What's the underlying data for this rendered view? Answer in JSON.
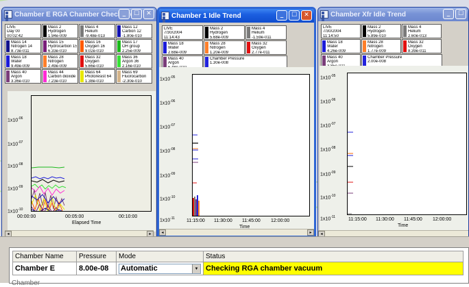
{
  "windows": [
    {
      "id": "e",
      "title": "Chamber E RGA Chamber Check Trend",
      "cells": [
        [
          "LIVE",
          "Day 00",
          "00:02:42"
        ],
        [
          "Mass 2",
          "Hydrogen",
          "1.94e-009"
        ],
        [
          "Mass 4",
          "Helium",
          "-9.48e-013"
        ],
        [
          "Mass 12",
          "Carbon 12",
          "-1.80e-010"
        ],
        [
          "Mass 14",
          "Nitrogen 14",
          "8.73e-011"
        ],
        [
          "Mass 15",
          "Hydrocarbon 15",
          "6.33e-010"
        ],
        [
          "Mass 16",
          "Oxygen 16",
          "9.02e-010"
        ],
        [
          "Mass 17",
          "OH group",
          "2.25e-009"
        ],
        [
          "Mass 18",
          "Water",
          "9.49e-009"
        ],
        [
          "Mass 28",
          "Nitrogen",
          "2.49e-009"
        ],
        [
          "Mass 32",
          "Oxygen",
          "5.66e-010"
        ],
        [
          "Mass 36",
          "Argon 36",
          "2.16e-010"
        ],
        [
          "Mass 40",
          "Argon",
          "3.36e-010"
        ],
        [
          "Mass 44",
          "Carbon dioxide",
          "7.23e-010"
        ],
        [
          "Mass 64",
          "Photoresist 64",
          "1.38e-010"
        ],
        [
          "Mass 69",
          "Fluorocarbon",
          "-2.30e-010"
        ]
      ],
      "y_ticks": [
        "1x10",
        "1x10",
        "1x10",
        "1x10",
        "1x10"
      ],
      "y_exps": [
        "-06",
        "-07",
        "-08",
        "-09",
        "-10"
      ],
      "x_ticks": [
        "00:00:00",
        "00:05:00",
        "00:10:00"
      ],
      "x_label": "Elapsed Time"
    },
    {
      "id": "1",
      "title": "Chamber 1 Idle Trend",
      "cells": [
        [
          "LIVE",
          "7/30/2004",
          "11:14:43"
        ],
        [
          "Mass 2",
          "Hydrogen",
          "5.68e-009"
        ],
        [
          "Mass 4",
          "Helium",
          "-1.59e-011"
        ],
        [
          "Mass 18",
          "Water",
          "2.68e-009"
        ],
        [
          "Mass 28",
          "Nitrogen",
          "1.20e-009"
        ],
        [
          "Mass 32",
          "Oxygen",
          "2.77e-011"
        ],
        [
          "Mass 40",
          "Argon",
          "6.48e-010"
        ],
        [
          "Chamber Pressure",
          "",
          "1.30e-008"
        ]
      ],
      "y_ticks": [
        "1x10",
        "1x10",
        "1x10",
        "1x10",
        "1x10",
        "1x10",
        "1x10"
      ],
      "y_exps": [
        "-05",
        "-06",
        "-07",
        "-08",
        "-09",
        "-10",
        "-11"
      ],
      "x_ticks": [
        "11:15:00",
        "11:30:00",
        "11:45:00",
        "12:00:00"
      ],
      "x_label": "Time"
    },
    {
      "id": "x",
      "title": "Chamber Xfr Idle Trend",
      "cells": [
        [
          "LIVE",
          "7/30/2004",
          "11:14:50"
        ],
        [
          "Mass 2",
          "Hydrogen",
          "5.89e-010"
        ],
        [
          "Mass 4",
          "Helium",
          "2.60e-013"
        ],
        [
          "Mass 18",
          "Water",
          "4.26e-009"
        ],
        [
          "Mass 28",
          "Nitrogen",
          "1.77e-009"
        ],
        [
          "Mass 32",
          "Oxygen",
          "8.39e-011"
        ],
        [
          "Mass 40",
          "Argon",
          "3.85e-011"
        ],
        [
          "Chamber Pressure",
          "",
          "2.00e-008"
        ]
      ],
      "y_ticks": [
        "1x10",
        "1x10",
        "1x10",
        "1x10",
        "1x10",
        "1x10",
        "1x10"
      ],
      "y_exps": [
        "-05",
        "-06",
        "-07",
        "-08",
        "-09",
        "-10",
        "-11"
      ],
      "x_ticks": [
        "11:15:00",
        "11:30:00",
        "11:45:00",
        "12:00:00"
      ],
      "x_label": "Time"
    }
  ],
  "colors": {
    "mass2": "#000000",
    "mass4": "#7a7a7a",
    "mass12": "#1414b4",
    "mass14": "#12128c",
    "mass15": "#7a1f7a",
    "mass16": "#ff5a00",
    "mass17": "#1bb81b",
    "mass18": "#1c1cd8",
    "mass28": "#ff7f2a",
    "mass32": "#e01010",
    "mass36": "#38e038",
    "mass40": "#7a3d7a",
    "mass44": "#ff2ad4",
    "mass64": "#e8e800",
    "mass69": "#d4b48a",
    "chamber_pressure": "#2222dd",
    "live": "#ffffff",
    "status_bg": "#ffff00"
  },
  "table": {
    "headers": [
      "Chamber Name",
      "Pressure",
      "Mode",
      "Status"
    ],
    "row": {
      "name": "Chamber E",
      "pressure": "8.00e-08",
      "mode": "Automatic",
      "status": "Checking RGA chamber vacuum"
    },
    "partial": "Chamber"
  }
}
